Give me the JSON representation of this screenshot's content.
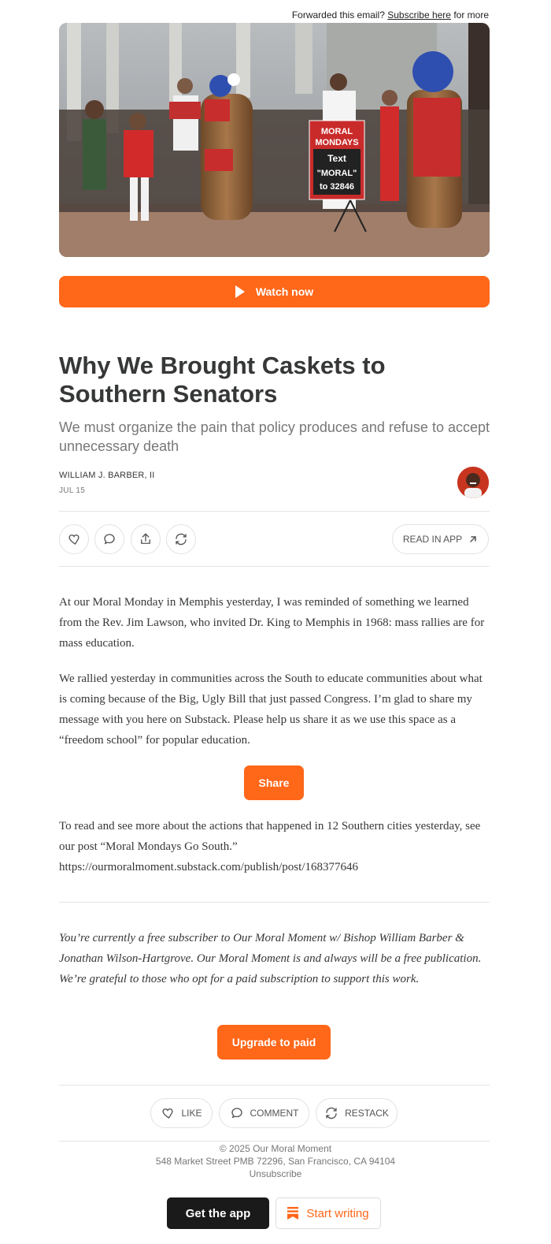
{
  "forwarded": {
    "prefix": "Forwarded this email?",
    "link": "Subscribe here",
    "suffix": "for more"
  },
  "hero": {
    "sign_text": [
      "MORAL",
      "MONDAYS",
      "Text",
      "\"MORAL\"",
      "to 32846"
    ]
  },
  "watch_button": {
    "label": "Watch now"
  },
  "post": {
    "title": "Why We Brought Caskets to Southern Senators",
    "subtitle": "We must organize the pain that policy produces and refuse to accept unnecessary death",
    "author": "WILLIAM J. BARBER, II",
    "date": "JUL 15"
  },
  "actions": {
    "read_in_app": "READ IN APP"
  },
  "body": {
    "p1": "At our Moral Monday in Memphis yesterday, I was reminded of something we learned from the Rev. Jim Lawson, who invited Dr. King to Memphis in 1968: mass rallies are for mass education.",
    "p2": "We rallied yesterday in communities across the South to educate communities about what is coming because of the Big, Ugly Bill that just passed Congress. I’m glad to share my message with you here on Substack. Please help us share it as we use this space as a “freedom school” for popular education.",
    "share_label": "Share",
    "p3": "To read and see more about the actions that happened in 12 Southern cities yesterday, see our post “Moral Mondays Go South.” https://ourmoralmoment.substack.com/publish/post/168377646",
    "subscriber_note": "You’re currently a free subscriber to Our Moral Moment w/ Bishop William Barber & Jonathan Wilson-Hartgrove. Our Moral Moment is and always will be a free publication. We’re grateful to those who opt for a paid subscription to support this work.",
    "upgrade_label": "Upgrade to paid"
  },
  "bottom_actions": {
    "like": "LIKE",
    "comment": "COMMENT",
    "restack": "RESTACK"
  },
  "footer": {
    "copyright": "© 2025 Our Moral Moment",
    "address": "548 Market Street PMB 72296, San Francisco, CA 94104",
    "unsubscribe": "Unsubscribe",
    "get_app": "Get the app",
    "start_writing": "Start writing"
  },
  "colors": {
    "accent": "#ff6719",
    "text": "#363737",
    "muted": "#777777",
    "dark_button": "#1a1a1a"
  }
}
